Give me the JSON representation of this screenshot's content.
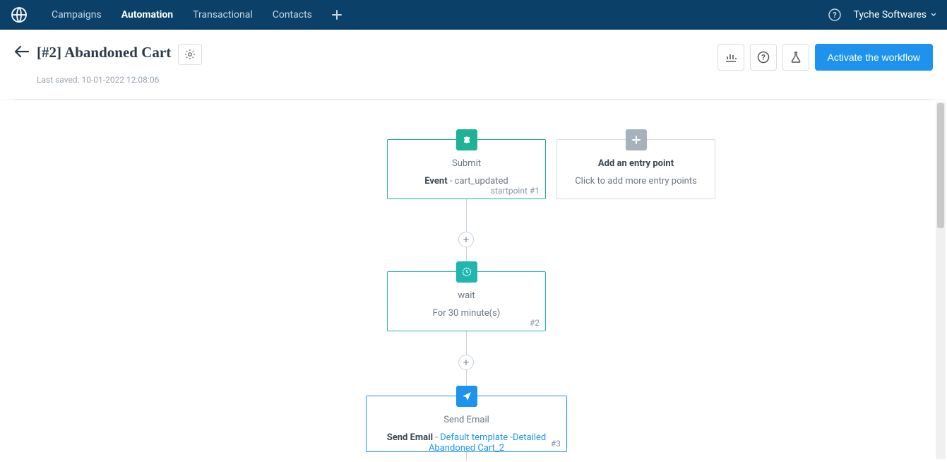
{
  "topbar": {
    "nav": [
      "Campaigns",
      "Automation",
      "Transactional",
      "Contacts"
    ],
    "active_index": 1,
    "user": "Tyche Softwares"
  },
  "header": {
    "title": "[#2] Abandoned Cart",
    "last_saved": "Last saved: 10-01-2022 12:08:06",
    "activate_label": "Activate the workflow"
  },
  "nodes": {
    "submit": {
      "title": "Submit",
      "event_label": "Event",
      "event_value": "cart_updated",
      "id_label": "startpoint #1"
    },
    "entry": {
      "title": "Add an entry point",
      "subtitle": "Click to add more entry points"
    },
    "wait": {
      "title": "wait",
      "subtitle": "For 30 minute(s)",
      "id_label": "#2"
    },
    "email": {
      "title": "Send Email",
      "action_label": "Send Email",
      "template": "Default template -Detailed Abandoned Cart_2",
      "id_label": "#3"
    }
  }
}
